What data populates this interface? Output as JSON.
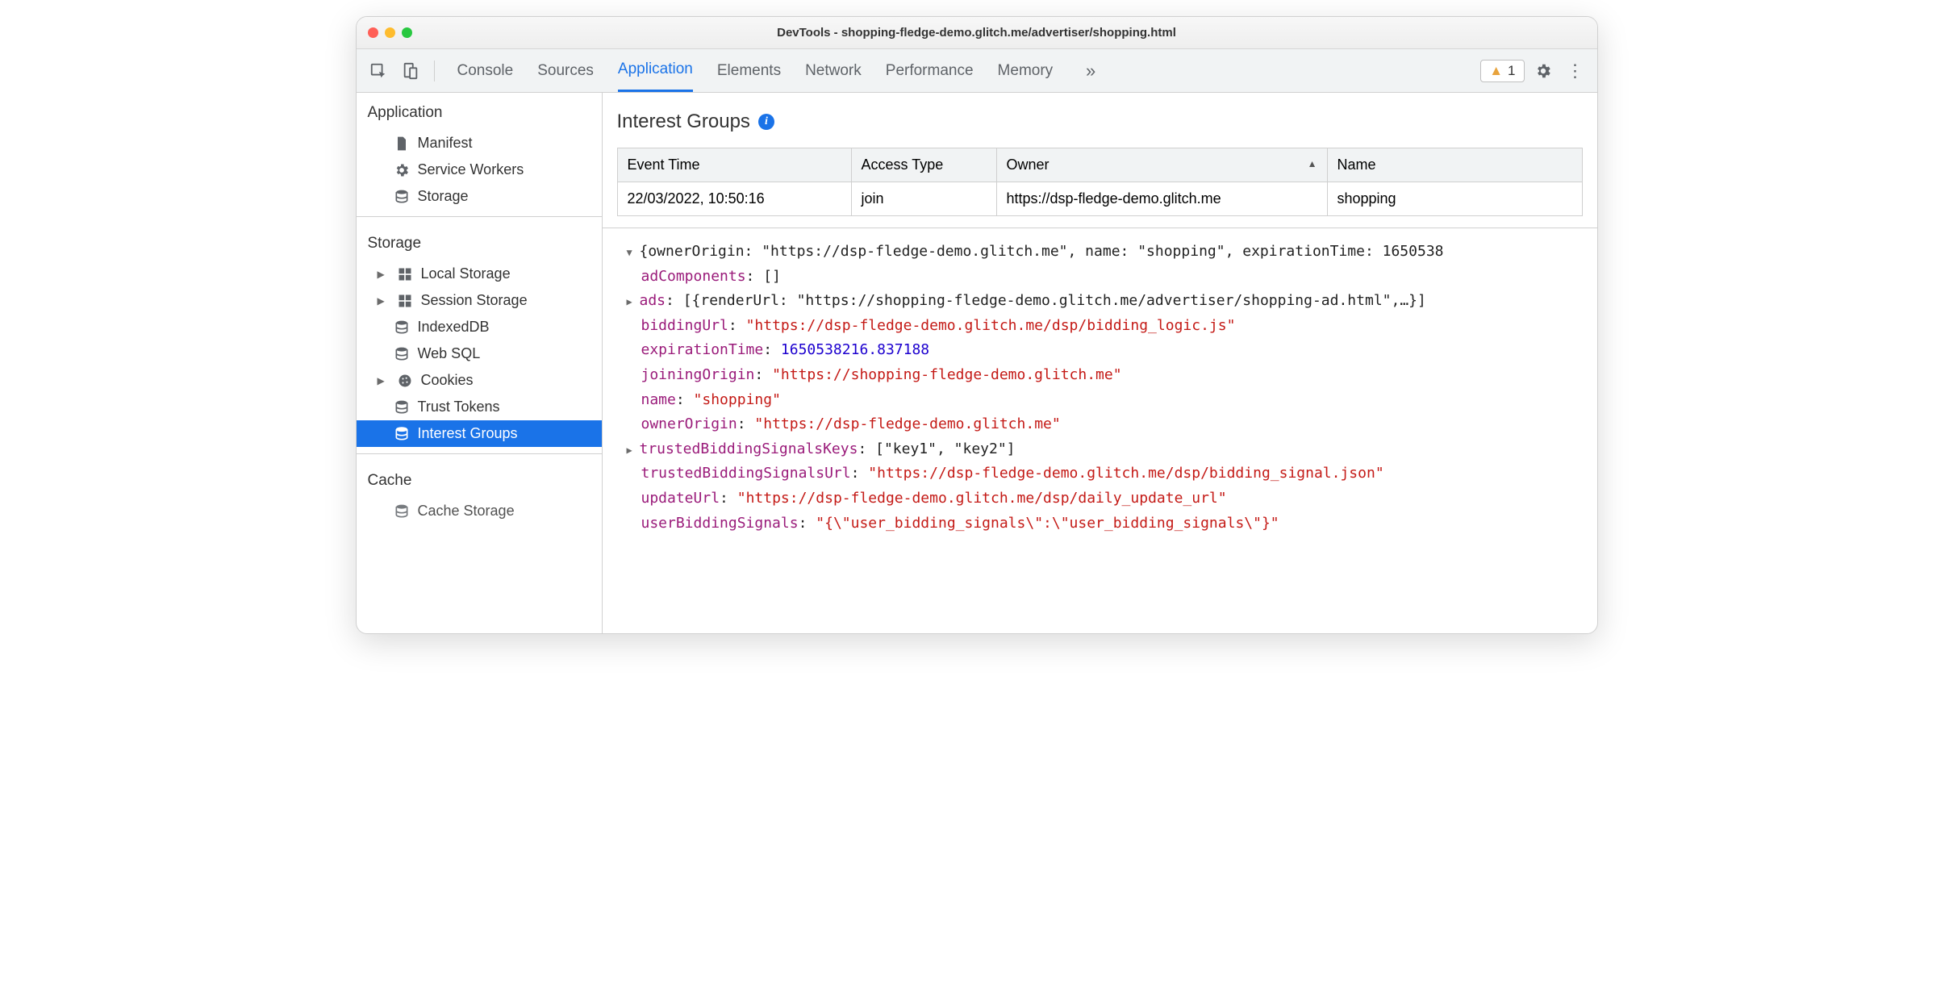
{
  "window": {
    "title": "DevTools - shopping-fledge-demo.glitch.me/advertiser/shopping.html"
  },
  "toolbar": {
    "tabs": [
      "Console",
      "Sources",
      "Application",
      "Elements",
      "Network",
      "Performance",
      "Memory"
    ],
    "active_tab": "Application",
    "warning_count": "1"
  },
  "sidebar": {
    "sections": [
      {
        "title": "Application",
        "items": [
          {
            "icon": "file-icon",
            "label": "Manifest"
          },
          {
            "icon": "gear-icon",
            "label": "Service Workers"
          },
          {
            "icon": "database-icon",
            "label": "Storage"
          }
        ]
      },
      {
        "title": "Storage",
        "items": [
          {
            "icon": "grid-icon",
            "label": "Local Storage",
            "arrow": true
          },
          {
            "icon": "grid-icon",
            "label": "Session Storage",
            "arrow": true
          },
          {
            "icon": "database-icon",
            "label": "IndexedDB"
          },
          {
            "icon": "database-icon",
            "label": "Web SQL"
          },
          {
            "icon": "cookie-icon",
            "label": "Cookies",
            "arrow": true
          },
          {
            "icon": "database-icon",
            "label": "Trust Tokens"
          },
          {
            "icon": "database-icon",
            "label": "Interest Groups",
            "selected": true
          }
        ]
      },
      {
        "title": "Cache",
        "items": [
          {
            "icon": "database-icon",
            "label": "Cache Storage"
          }
        ]
      }
    ]
  },
  "main": {
    "heading": "Interest Groups",
    "table": {
      "headers": [
        "Event Time",
        "Access Type",
        "Owner",
        "Name"
      ],
      "sort_col": 2,
      "rows": [
        [
          "22/03/2022, 10:50:16",
          "join",
          "https://dsp-fledge-demo.glitch.me",
          "shopping"
        ]
      ]
    },
    "json": {
      "summary": "{ownerOrigin: \"https://dsp-fledge-demo.glitch.me\", name: \"shopping\", expirationTime: 1650538",
      "adComponents": "[]",
      "ads_summary": "[{renderUrl: \"https://shopping-fledge-demo.glitch.me/advertiser/shopping-ad.html\",…}]",
      "biddingUrl": "\"https://dsp-fledge-demo.glitch.me/dsp/bidding_logic.js\"",
      "expirationTime": "1650538216.837188",
      "joiningOrigin": "\"https://shopping-fledge-demo.glitch.me\"",
      "name": "\"shopping\"",
      "ownerOrigin": "\"https://dsp-fledge-demo.glitch.me\"",
      "trustedBiddingSignalsKeys": "[\"key1\", \"key2\"]",
      "trustedBiddingSignalsUrl": "\"https://dsp-fledge-demo.glitch.me/dsp/bidding_signal.json\"",
      "updateUrl": "\"https://dsp-fledge-demo.glitch.me/dsp/daily_update_url\"",
      "userBiddingSignals": "\"{\\\"user_bidding_signals\\\":\\\"user_bidding_signals\\\"}\""
    }
  }
}
